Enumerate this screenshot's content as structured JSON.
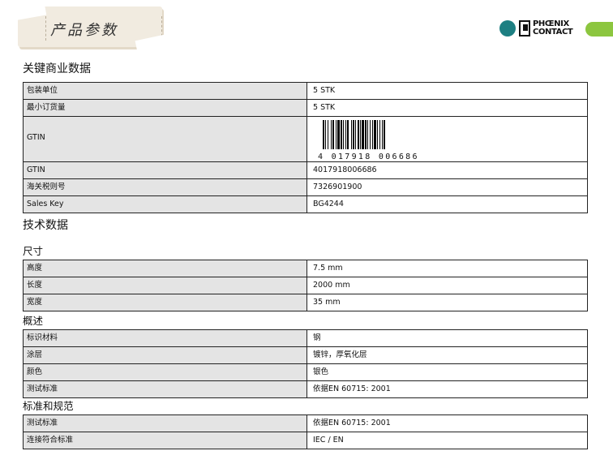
{
  "header": {
    "banner_title": "产品参数",
    "logo_text_line1": "PHŒNIX",
    "logo_text_line2": "CONTACT",
    "logo_colors": {
      "teal": "#1d7f82",
      "green": "#8cc63f"
    }
  },
  "commercial": {
    "title": "关键商业数据",
    "rows": [
      {
        "key": "包装单位",
        "value": "5 STK"
      },
      {
        "key": "最小订货量",
        "value": "5 STK"
      },
      {
        "key": "GTIN",
        "value": "",
        "barcode_digits": "4 017918 006686"
      },
      {
        "key": "GTIN",
        "value": "4017918006686"
      },
      {
        "key": "海关税则号",
        "value": "7326901900"
      },
      {
        "key": "Sales Key",
        "value": "BG4244"
      }
    ]
  },
  "technical": {
    "title": "技术数据",
    "sections": [
      {
        "title": "尺寸",
        "rows": [
          {
            "key": "高度",
            "value": "7.5 mm"
          },
          {
            "key": "长度",
            "value": "2000 mm"
          },
          {
            "key": "宽度",
            "value": "35 mm"
          }
        ]
      },
      {
        "title": "概述",
        "rows": [
          {
            "key": "标识材料",
            "value": "钢"
          },
          {
            "key": "涂层",
            "value": "镀锌，厚氧化层"
          },
          {
            "key": "颜色",
            "value": "银色"
          },
          {
            "key": "测试标准",
            "value": "依据EN 60715: 2001"
          }
        ]
      },
      {
        "title": "标准和规范",
        "rows": [
          {
            "key": "测试标准",
            "value": "依据EN 60715: 2001"
          },
          {
            "key": "连接符合标准",
            "value": "IEC / EN"
          }
        ]
      }
    ]
  }
}
